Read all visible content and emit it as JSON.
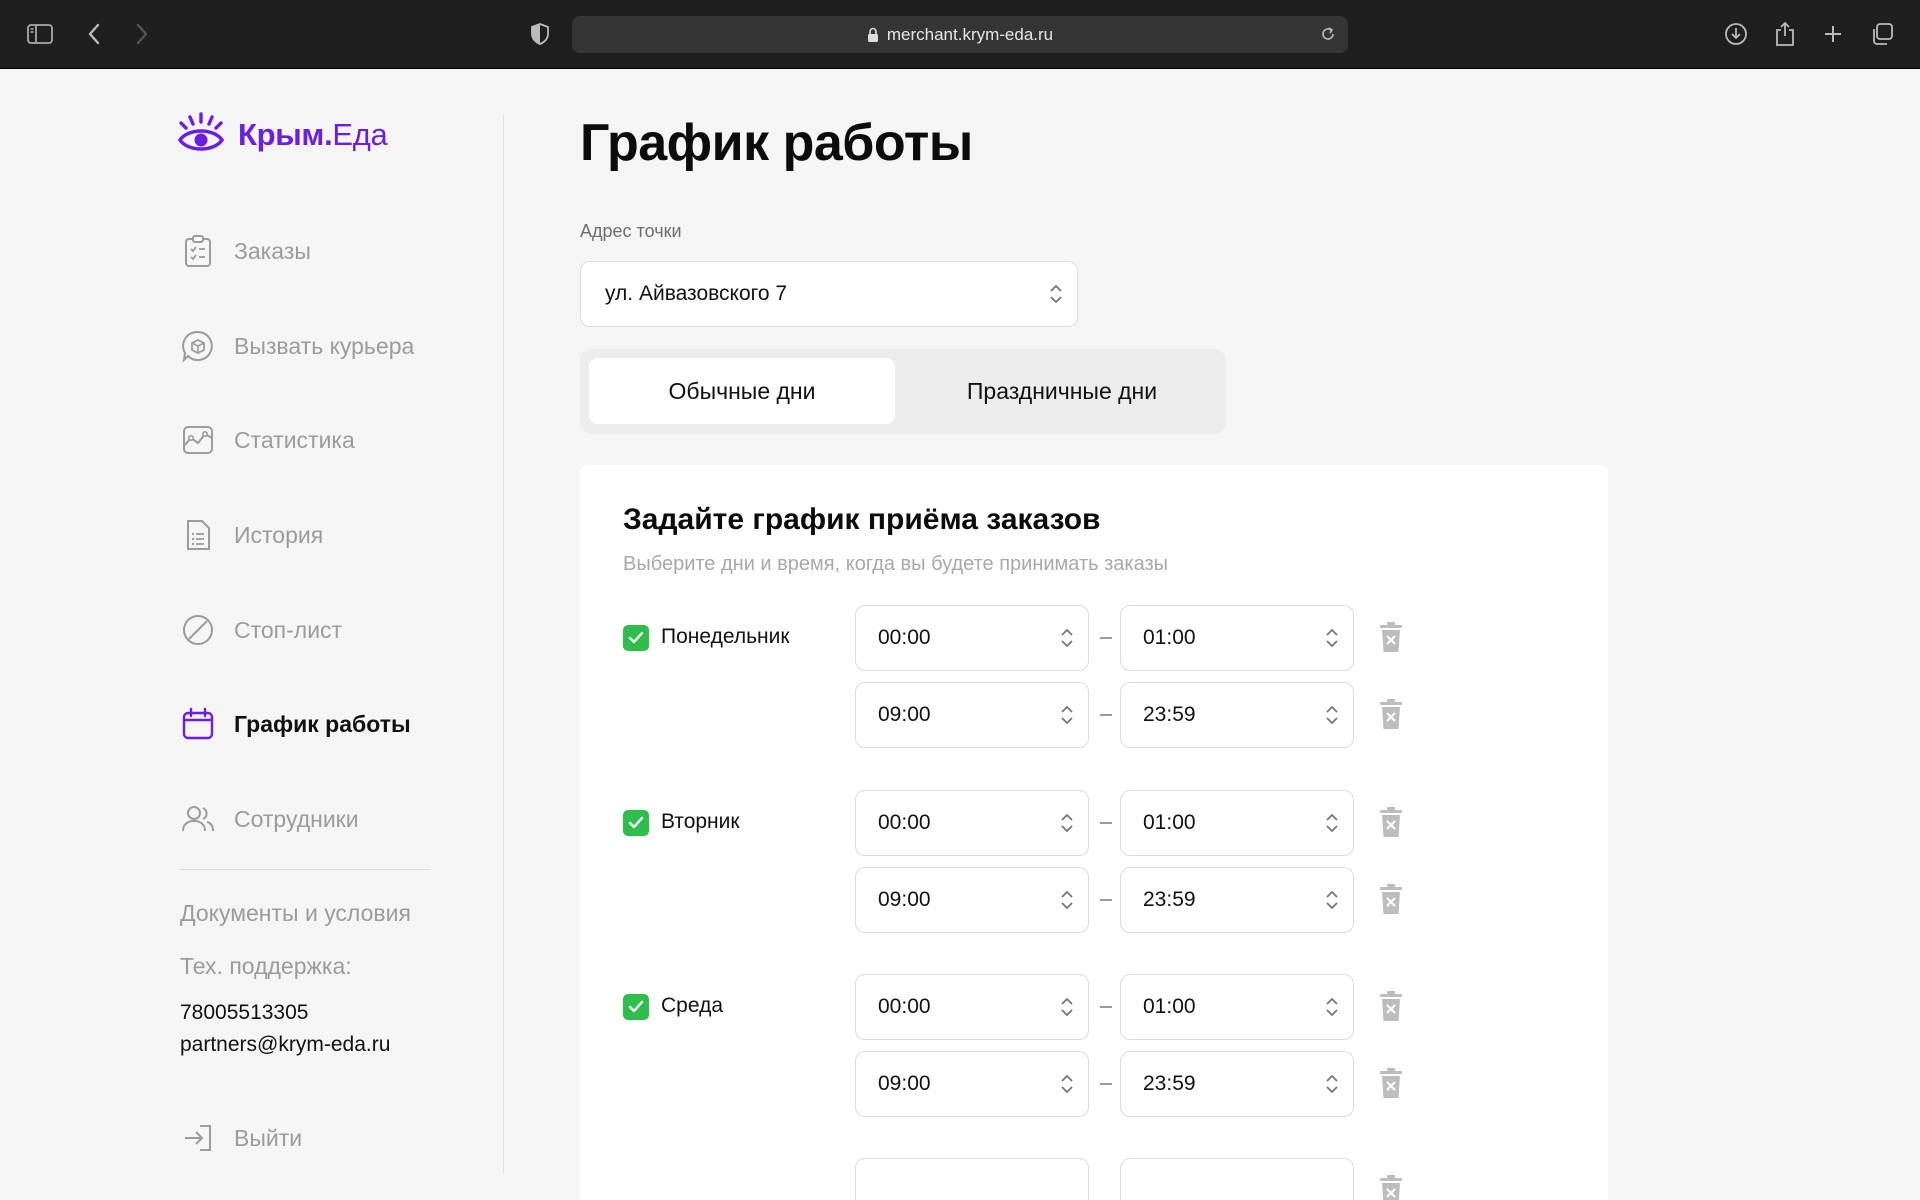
{
  "browser": {
    "url": "merchant.krym-eda.ru"
  },
  "logo": {
    "brand": "Крым.",
    "brand_light": "Еда"
  },
  "sidebar": {
    "items": [
      {
        "label": "Заказы",
        "icon": "clipboard-list-icon",
        "active": false
      },
      {
        "label": "Вызвать курьера",
        "icon": "courier-chat-icon",
        "active": false
      },
      {
        "label": "Статистика",
        "icon": "statistics-icon",
        "active": false
      },
      {
        "label": "История",
        "icon": "document-list-icon",
        "active": false
      },
      {
        "label": "Стоп-лист",
        "icon": "stop-circle-icon",
        "active": false
      },
      {
        "label": "График работы",
        "icon": "calendar-icon",
        "active": true
      },
      {
        "label": "Сотрудники",
        "icon": "users-icon",
        "active": false
      }
    ],
    "documents_link": "Документы и условия",
    "support_label": "Тех. поддержка:",
    "support_phone": "78005513305",
    "support_email": "partners@krym-eda.ru",
    "logout_label": "Выйти"
  },
  "main": {
    "title": "График работы",
    "address_label": "Адрес точки",
    "address_value": "ул. Айвазовского 7",
    "tabs": [
      {
        "label": "Обычные дни",
        "active": true
      },
      {
        "label": "Праздничные дни",
        "active": false
      }
    ],
    "card": {
      "title": "Задайте график приёма заказов",
      "subtitle": "Выберите дни и время, когда вы будете принимать заказы"
    },
    "days": [
      {
        "name": "Понедельник",
        "checked": true,
        "intervals": [
          {
            "from": "00:00",
            "to": "01:00"
          },
          {
            "from": "09:00",
            "to": "23:59"
          }
        ]
      },
      {
        "name": "Вторник",
        "checked": true,
        "intervals": [
          {
            "from": "00:00",
            "to": "01:00"
          },
          {
            "from": "09:00",
            "to": "23:59"
          }
        ]
      },
      {
        "name": "Среда",
        "checked": true,
        "intervals": [
          {
            "from": "00:00",
            "to": "01:00"
          },
          {
            "from": "09:00",
            "to": "23:59"
          }
        ]
      }
    ]
  },
  "colors": {
    "brand": "#6b1fe6",
    "check_green": "#2fbd4c",
    "chrome_bg": "#1f1f1f"
  }
}
